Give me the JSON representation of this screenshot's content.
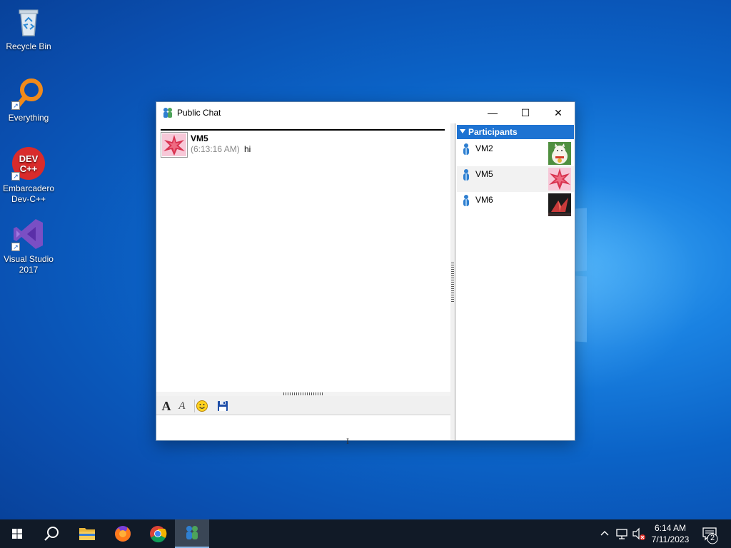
{
  "desktop": {
    "icons": [
      {
        "label": "Recycle Bin"
      },
      {
        "label": "Everything"
      },
      {
        "label": "Embarcadero Dev-C++"
      },
      {
        "label": "Visual Studio 2017"
      }
    ],
    "devcpp_logo_text": "DEV C++"
  },
  "window": {
    "title": "Public Chat",
    "controls": {
      "minimize": "—",
      "maximize": "☐",
      "close": "✕"
    }
  },
  "chat": {
    "messages": [
      {
        "sender": "VM5",
        "time": "(6:13:16 AM)",
        "text": "hi"
      }
    ]
  },
  "toolbar": {
    "font_label": "A",
    "style_label": "A"
  },
  "participants": {
    "header": "Participants",
    "items": [
      {
        "name": "VM2"
      },
      {
        "name": "VM5"
      },
      {
        "name": "VM6"
      }
    ]
  },
  "taskbar": {
    "time": "6:14 AM",
    "date": "7/11/2023",
    "notification_count": "2"
  }
}
